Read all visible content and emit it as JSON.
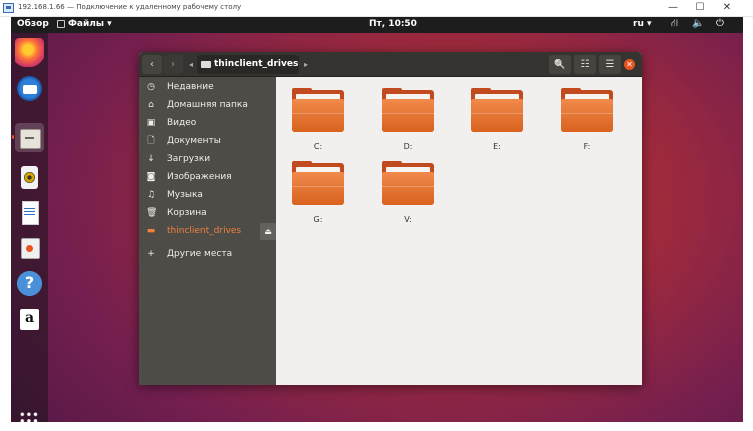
{
  "rdp": {
    "title": "192.168.1.66 — Подключение к удаленному рабочему столу",
    "minimize": "—",
    "maximize": "☐",
    "close": "✕"
  },
  "top_panel": {
    "activities": "Обзор",
    "app_menu": "Файлы ▾",
    "clock": "Пт, 10:50",
    "language": "ru ▾",
    "network_icon": "⛙",
    "volume_icon": "🔈",
    "power_icon": "⏻"
  },
  "dock": {
    "items": [
      "firefox-icon",
      "thunderbird-icon",
      "files-icon",
      "rhythmbox-icon",
      "writer-icon",
      "software-center-icon",
      "help-icon",
      "amazon-icon"
    ],
    "help_glyph": "?",
    "amazon_glyph": "a"
  },
  "headerbar": {
    "back": "‹",
    "forward": "›",
    "path_left": "◂",
    "path_right": "▸",
    "current_location": "thinclient_drives",
    "search_icon": "🔍",
    "view_icon": "☷",
    "menu_icon": "☰",
    "close": "✕"
  },
  "sidebar": {
    "items": [
      {
        "icon": "◷",
        "label": "Недавние"
      },
      {
        "icon": "⌂",
        "label": "Домашняя папка"
      },
      {
        "icon": "▣",
        "label": "Видео"
      },
      {
        "icon": "🗋",
        "label": "Документы"
      },
      {
        "icon": "↓",
        "label": "Загрузки"
      },
      {
        "icon": "◙",
        "label": "Изображения"
      },
      {
        "icon": "♫",
        "label": "Музыка"
      },
      {
        "icon": "🗑",
        "label": "Корзина"
      },
      {
        "icon": "▬",
        "label": "thinclient_drives"
      }
    ],
    "eject_icon": "⏏",
    "other_icon": "+",
    "other_places": "Другие места"
  },
  "folders": [
    {
      "name": "C:"
    },
    {
      "name": "D:"
    },
    {
      "name": "E:"
    },
    {
      "name": "F:"
    },
    {
      "name": "G:"
    },
    {
      "name": "V:"
    }
  ],
  "colors": {
    "accent": "#e95420",
    "folder": "#e4733a",
    "sidebar_bg": "#4e4c47",
    "headerbar_bg": "#363430"
  }
}
